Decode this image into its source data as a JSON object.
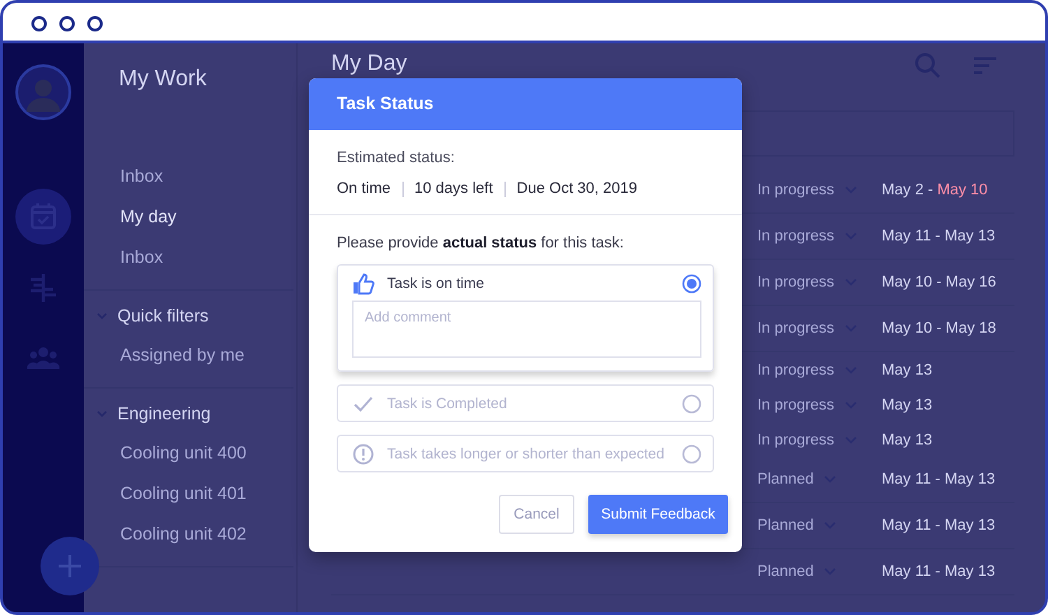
{
  "rail": {
    "nav": [
      {
        "kind": "calendar",
        "selected": true
      },
      {
        "kind": "hierarchy",
        "selected": false
      },
      {
        "kind": "people",
        "selected": false
      }
    ]
  },
  "sidebar": {
    "title": "My Work",
    "items": [
      {
        "label": "Inbox",
        "selected": false
      },
      {
        "label": "My day",
        "selected": true
      },
      {
        "label": "Inbox",
        "selected": false
      }
    ],
    "groups": [
      {
        "title": "Quick filters",
        "expanded": true,
        "items": [
          {
            "label": "Assigned by me"
          }
        ]
      },
      {
        "title": "Engineering",
        "expanded": true,
        "items": [
          {
            "label": "Cooling unit 400"
          },
          {
            "label": "Cooling unit 401"
          },
          {
            "label": "Cooling unit 402"
          }
        ]
      }
    ]
  },
  "main": {
    "title": "My Day",
    "rows": [
      {
        "kind": "task",
        "status": "In progress",
        "start": "May 2 -",
        "end": "May 10",
        "overdue": true
      },
      {
        "kind": "task",
        "status": "In progress",
        "start": "May 11 -",
        "end": "May 13",
        "overdue": false
      },
      {
        "kind": "task",
        "status": "In progress",
        "start": "May 10 -",
        "end": "May 16",
        "overdue": false
      },
      {
        "kind": "task",
        "status": "In progress",
        "start": "May 10 -",
        "end": "May 18",
        "overdue": false
      },
      {
        "kind": "subtask",
        "status": "In progress",
        "start": "May 13",
        "overdue": false
      },
      {
        "kind": "subtask",
        "status": "In progress",
        "start": "May 13",
        "overdue": false
      },
      {
        "kind": "subtask",
        "status": "In progress",
        "start": "May 13",
        "overdue": false
      },
      {
        "kind": "task",
        "status": "Planned",
        "start": "May 11 -",
        "end": "May 13",
        "overdue": false
      },
      {
        "kind": "task",
        "status": "Planned",
        "start": "May 11 -",
        "end": "May 13",
        "overdue": false
      },
      {
        "kind": "task",
        "status": "Planned",
        "start": "May 11 -",
        "end": "May 13",
        "overdue": false
      }
    ]
  },
  "dialog": {
    "title": "Task Status",
    "estimated_label": "Estimated status:",
    "estimated": [
      "On time",
      "10 days left",
      "Due Oct 30, 2019"
    ],
    "prompt": "Please provide **actual status** for this task:",
    "options": [
      {
        "kind": "on_time",
        "label": "Task is on time",
        "selected": true,
        "placeholder": "Add comment"
      },
      {
        "kind": "completed",
        "label": "Task is Completed",
        "selected": false
      },
      {
        "kind": "deviation",
        "label": "Task takes longer or shorter than expected",
        "selected": false
      }
    ],
    "buttons": [
      {
        "kind": "secondary",
        "label": "Cancel"
      },
      {
        "kind": "primary",
        "label": "Submit Feedback"
      }
    ]
  }
}
